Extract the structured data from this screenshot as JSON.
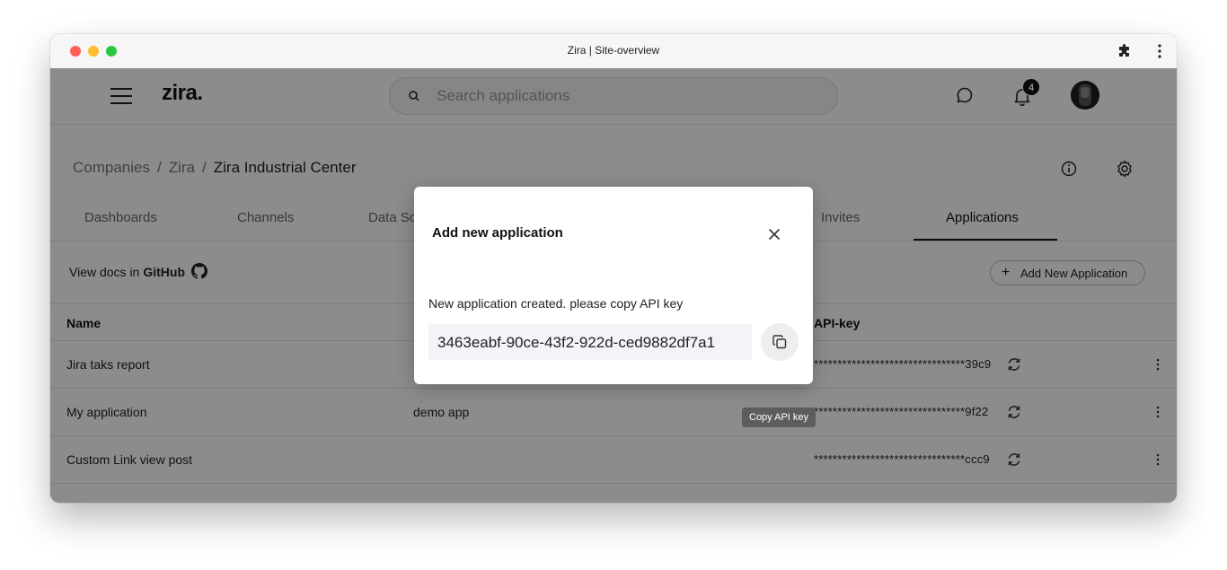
{
  "browser": {
    "title": "Zira | Site-overview"
  },
  "header": {
    "logo": "zira.",
    "search_placeholder": "Search applications",
    "notification_count": "4"
  },
  "breadcrumb": {
    "items": [
      "Companies",
      "Zira",
      "Zira Industrial Center"
    ]
  },
  "tabs": [
    {
      "label": "Dashboards"
    },
    {
      "label": "Channels"
    },
    {
      "label": "Data Sources"
    },
    {
      "label": "Invites"
    },
    {
      "label": "Applications"
    }
  ],
  "toolbar": {
    "docs_label": "View docs in",
    "docs_link": "GitHub",
    "add_button": "Add New Application"
  },
  "table": {
    "headers": [
      "Name",
      "API-key"
    ],
    "rows": [
      {
        "name": "Jira taks report",
        "description": "",
        "key": "********************************39c9"
      },
      {
        "name": "My application",
        "description": "demo app",
        "key": "********************************9f22"
      },
      {
        "name": "Custom Link view post",
        "description": "",
        "key": "********************************ccc9"
      }
    ]
  },
  "modal": {
    "title": "Add new application",
    "message": "New application created. please copy API key",
    "api_key": "3463eabf-90ce-43f2-922d-ced9882df7a1",
    "copy_tooltip": "Copy API key"
  }
}
